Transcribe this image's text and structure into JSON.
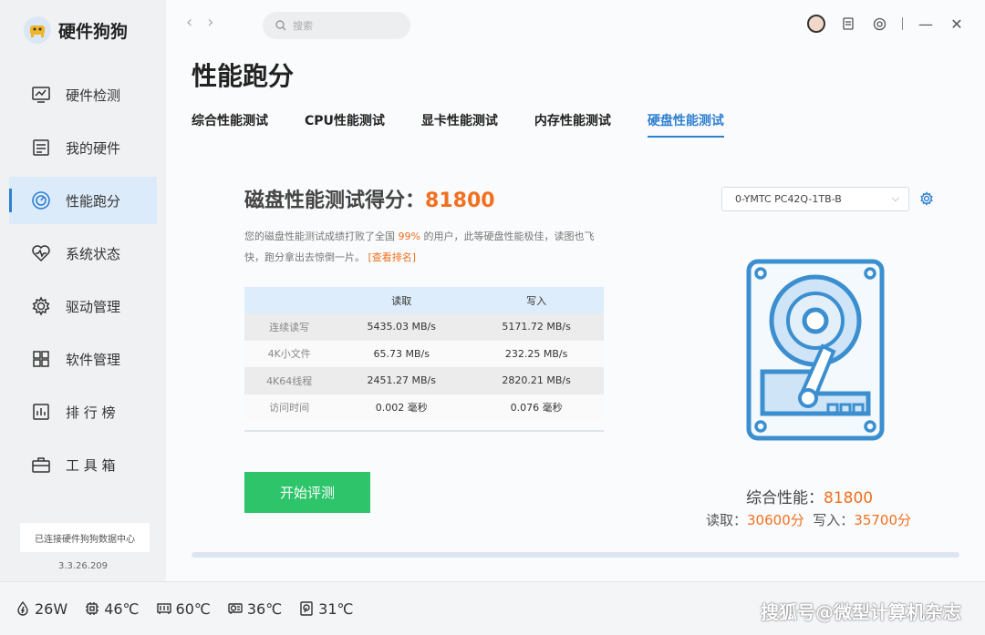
{
  "app": {
    "name": "硬件狗狗"
  },
  "sidebar": {
    "items": [
      {
        "label": "硬件检测",
        "icon": "monitor-chart-icon"
      },
      {
        "label": "我的硬件",
        "icon": "hardware-list-icon"
      },
      {
        "label": "性能跑分",
        "icon": "speedometer-icon",
        "active": true
      },
      {
        "label": "系统状态",
        "icon": "heartbeat-icon"
      },
      {
        "label": "驱动管理",
        "icon": "gear-icon"
      },
      {
        "label": "软件管理",
        "icon": "apps-grid-icon"
      },
      {
        "label": "排 行 榜",
        "icon": "ranking-chart-icon"
      },
      {
        "label": "工 具 箱",
        "icon": "toolbox-icon"
      }
    ],
    "connect_status": "已连接硬件狗狗数据中心",
    "version": "3.3.26.209"
  },
  "header": {
    "back": "‹",
    "forward": "›",
    "search_placeholder": "搜索",
    "minimize": "—",
    "close": "✕"
  },
  "page": {
    "title": "性能跑分",
    "tabs": [
      {
        "label": "综合性能测试"
      },
      {
        "label": "CPU性能测试"
      },
      {
        "label": "显卡性能测试"
      },
      {
        "label": "内存性能测试"
      },
      {
        "label": "硬盘性能测试",
        "active": true
      }
    ]
  },
  "disk": {
    "score_label": "磁盘性能测试得分：",
    "score": "81800",
    "desc_part1": "您的磁盘性能测试成绩打败了全国 ",
    "desc_percent": "99%",
    "desc_part2": " 的用户，此等硬盘性能极佳，读图也飞快，跑分拿出去惊倒一片。 ",
    "rank_link": "[查看排名]",
    "table": {
      "headers": [
        "",
        "读取",
        "写入"
      ],
      "rows": [
        [
          "连续读写",
          "5435.03 MB/s",
          "5171.72 MB/s"
        ],
        [
          "4K小文件",
          "65.73 MB/s",
          "232.25 MB/s"
        ],
        [
          "4K64线程",
          "2451.27 MB/s",
          "2820.21 MB/s"
        ],
        [
          "访问时间",
          "0.002 毫秒",
          "0.076 毫秒"
        ]
      ]
    },
    "start_button": "开始评测",
    "drive": "0-YMTC PC42Q-1TB-B",
    "summary_label": "综合性能：",
    "summary_score": "81800",
    "read_label": "读取：",
    "read_score": "30600分",
    "write_label": "写入：",
    "write_score": "35700分"
  },
  "status_bar": {
    "power": "26W",
    "cpu_temp": "46℃",
    "mem_temp": "60℃",
    "gpu_temp": "36℃",
    "disk_temp": "31℃"
  },
  "watermark": "搜狐号@微型计算机杂志",
  "colors": {
    "accent": "#2f80d1",
    "highlight": "#f07020",
    "start": "#2dc46a"
  }
}
